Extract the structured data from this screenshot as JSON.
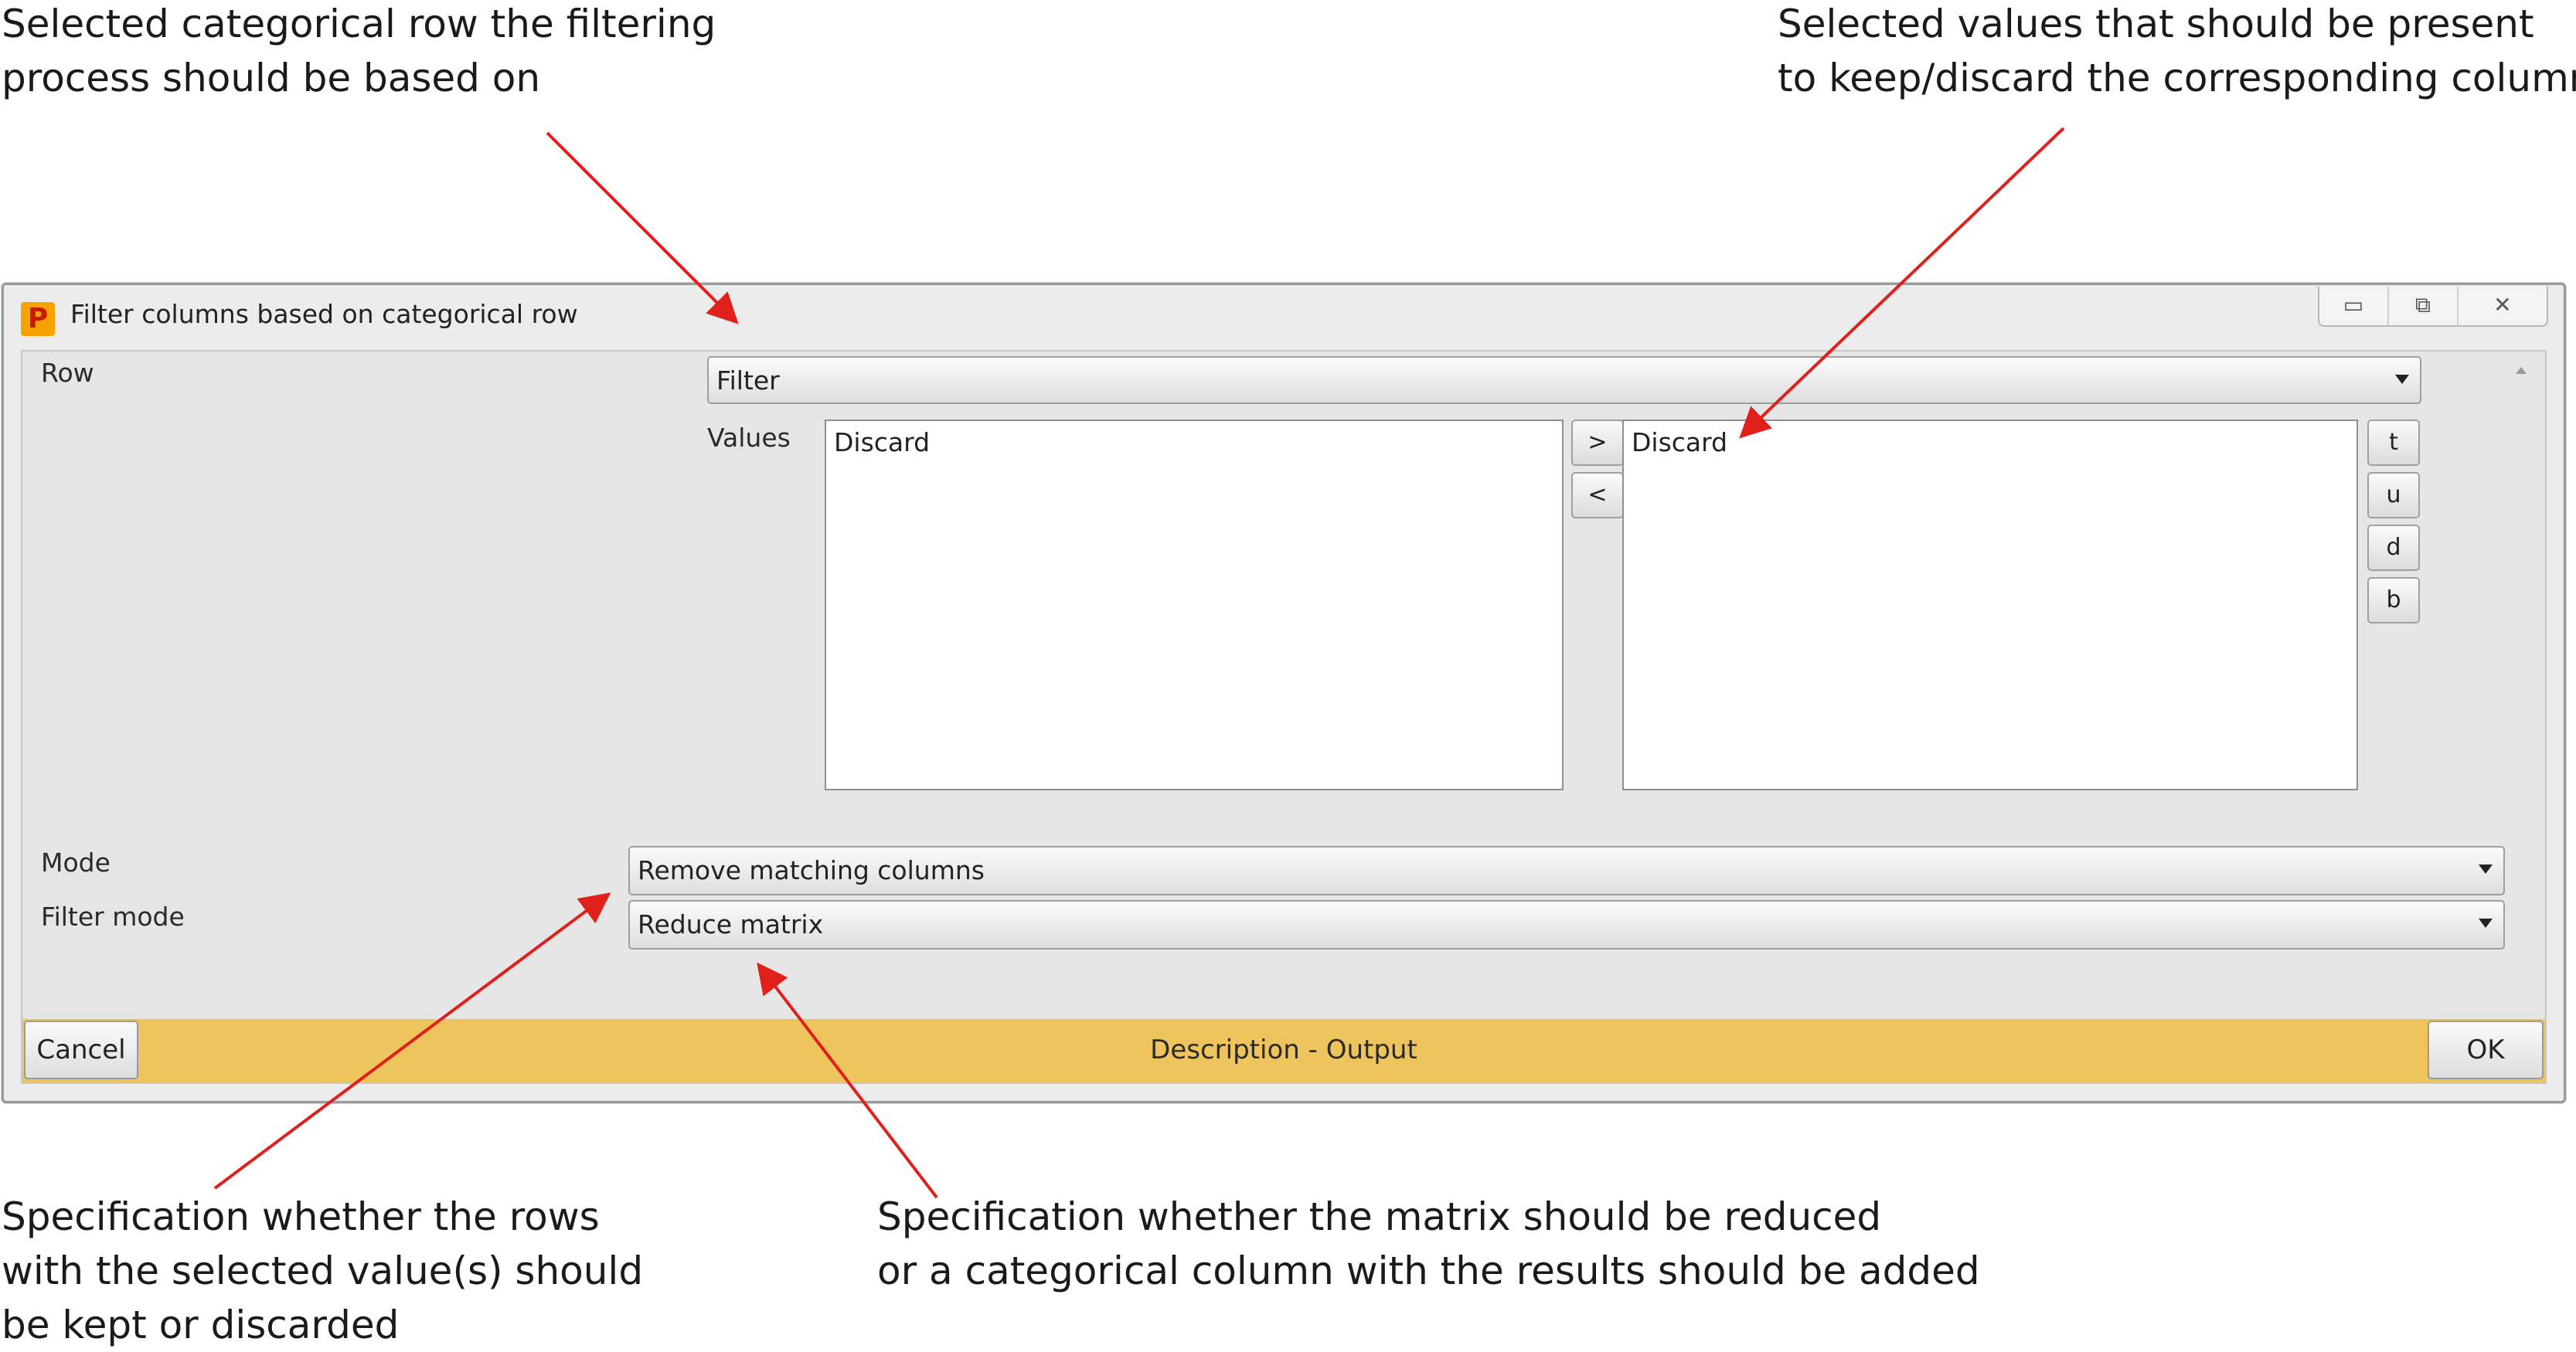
{
  "annotations": {
    "top_left": [
      "Selected categorical row the filtering",
      "process should be based on"
    ],
    "top_right": [
      "Selected values that should be present",
      "to keep/discard the corresponding column"
    ],
    "bottom_left": [
      "Specification whether the rows",
      "with the selected value(s) should",
      "be kept or discarded"
    ],
    "bottom_right": [
      "Specification whether the matrix should be reduced",
      "or a categorical column with the results should be added"
    ]
  },
  "window": {
    "title": "Filter columns based on categorical row",
    "icon": "perseus-app-icon",
    "controls": {
      "minimize": "▭",
      "maximize": "⧉",
      "close": "✕"
    }
  },
  "form": {
    "row_label": "Row",
    "row_value": "Filter",
    "values_label": "Values",
    "available_values": [
      "Discard"
    ],
    "selected_values": [
      "Discard"
    ],
    "move_right": ">",
    "move_left": "<",
    "order_buttons": [
      "t",
      "u",
      "d",
      "b"
    ],
    "mode_label": "Mode",
    "mode_value": "Remove matching columns",
    "filter_mode_label": "Filter mode",
    "filter_mode_value": "Reduce matrix"
  },
  "statusbar": {
    "cancel": "Cancel",
    "text": "Description - Output",
    "ok": "OK"
  },
  "colors": {
    "statusbar": "#eec55c",
    "arrow": "#e0201b"
  }
}
